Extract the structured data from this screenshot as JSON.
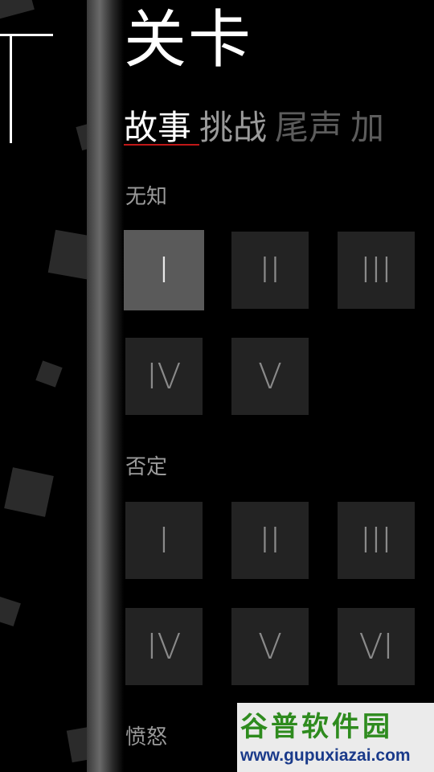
{
  "page": {
    "title": "关卡"
  },
  "tabs": [
    {
      "label": "故事"
    },
    {
      "label": "挑战"
    },
    {
      "label": "尾声"
    },
    {
      "label": "加"
    }
  ],
  "sections": [
    {
      "label": "无知",
      "levels": [
        "I",
        "II",
        "III",
        "IV",
        "V"
      ],
      "selected_index": 0
    },
    {
      "label": "否定",
      "levels": [
        "I",
        "II",
        "III",
        "IV",
        "V",
        "VI"
      ]
    },
    {
      "label": "愤怒"
    }
  ],
  "watermark": {
    "logo_text": "谷普软件园",
    "url": "www.gupuxiazai.com"
  },
  "colors": {
    "background": "#000000",
    "tile": "#232323",
    "tile_selected": "#5a5a5a",
    "active_underline": "#c01818",
    "watermark_green": "#2e8b1e"
  }
}
